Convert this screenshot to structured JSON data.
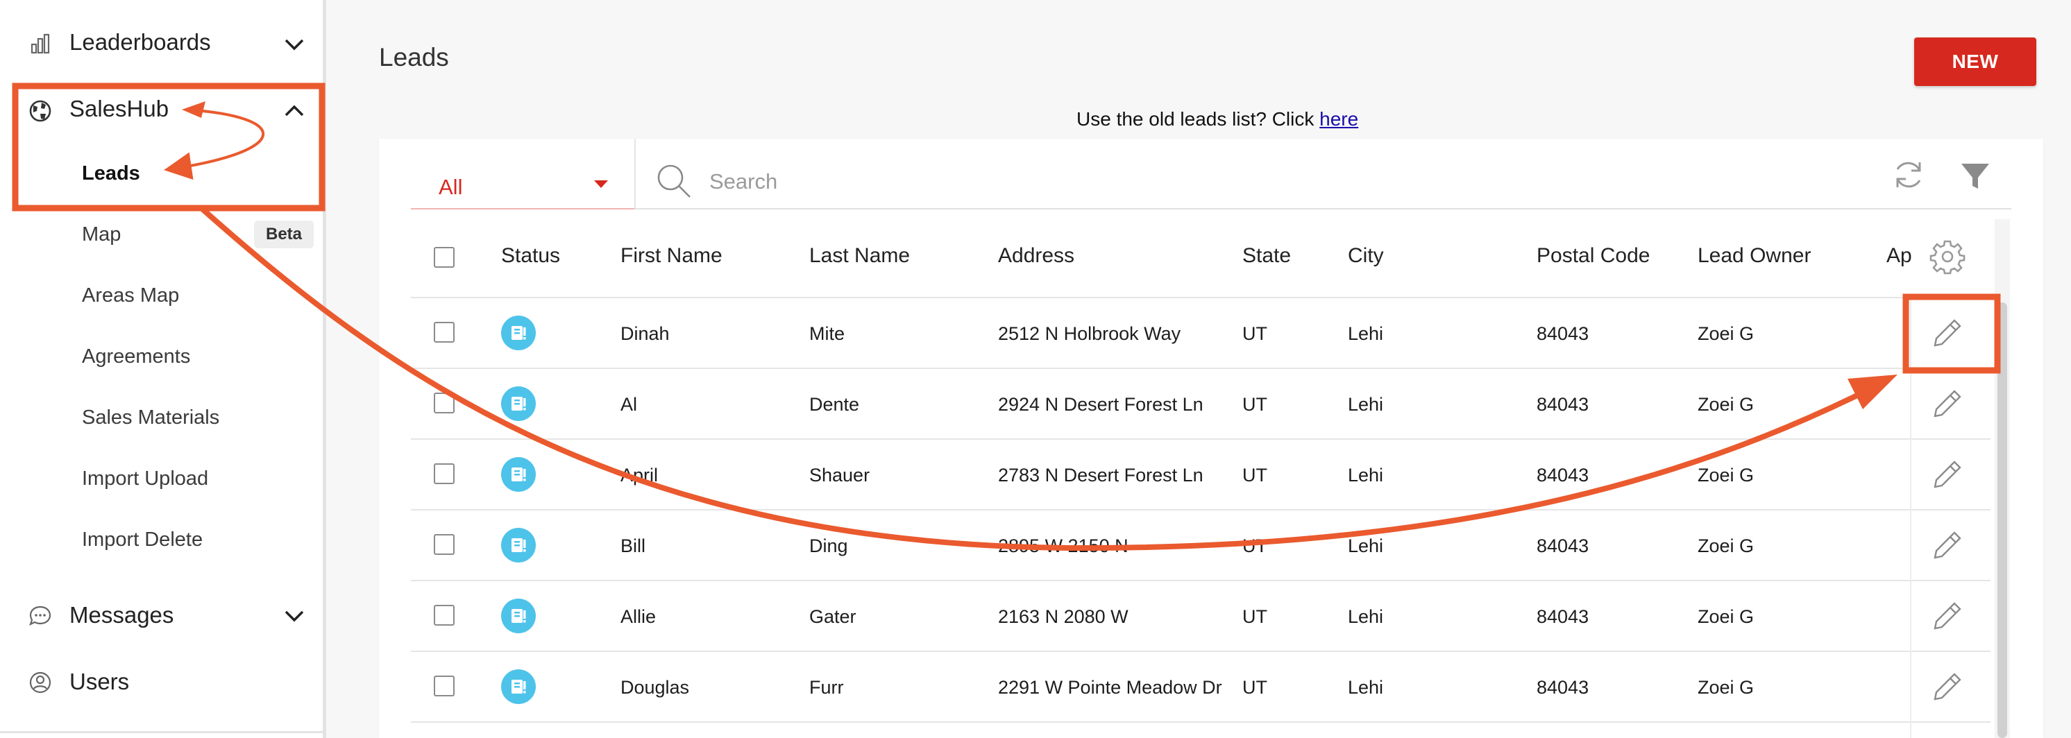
{
  "sidebar": {
    "leaderboards_label": "Leaderboards",
    "saleshub_label": "SalesHub",
    "sub_items": {
      "leads": "Leads",
      "map": "Map",
      "map_badge": "Beta",
      "areas_map": "Areas Map",
      "agreements": "Agreements",
      "sales_materials": "Sales Materials",
      "import_upload": "Import Upload",
      "import_delete": "Import Delete"
    },
    "messages_label": "Messages",
    "users_label": "Users"
  },
  "header": {
    "title": "Leads",
    "new_button": "NEW",
    "old_list_text": "Use the old leads list? Click ",
    "old_list_link": "here"
  },
  "toolbar": {
    "filter_value": "All",
    "search_placeholder": "Search"
  },
  "table": {
    "columns": [
      "Status",
      "First Name",
      "Last Name",
      "Address",
      "State",
      "City",
      "Postal Code",
      "Lead Owner",
      "Ap"
    ],
    "rows": [
      {
        "first": "Dinah",
        "last": "Mite",
        "address": "2512 N Holbrook Way",
        "state": "UT",
        "city": "Lehi",
        "postal": "84043",
        "owner": "Zoei G"
      },
      {
        "first": "Al",
        "last": "Dente",
        "address": "2924 N Desert Forest Ln",
        "state": "UT",
        "city": "Lehi",
        "postal": "84043",
        "owner": "Zoei G"
      },
      {
        "first": "April",
        "last": "Shauer",
        "address": "2783 N Desert Forest Ln",
        "state": "UT",
        "city": "Lehi",
        "postal": "84043",
        "owner": "Zoei G"
      },
      {
        "first": "Bill",
        "last": "Ding",
        "address": "2895 W 2150 N",
        "state": "UT",
        "city": "Lehi",
        "postal": "84043",
        "owner": "Zoei G"
      },
      {
        "first": "Allie",
        "last": "Gater",
        "address": "2163 N 2080 W",
        "state": "UT",
        "city": "Lehi",
        "postal": "84043",
        "owner": "Zoei G"
      },
      {
        "first": "Douglas",
        "last": "Furr",
        "address": "2291 W Pointe Meadow Dr",
        "state": "UT",
        "city": "Lehi",
        "postal": "84043",
        "owner": "Zoei G"
      }
    ]
  },
  "colors": {
    "accent": "#d6281f",
    "status_icon": "#4dc3ea",
    "annotation": "#ea5a2e"
  },
  "icons": [
    "chart-bar-icon",
    "globe-icon",
    "chevron-down-icon",
    "chevron-up-icon",
    "message-icon",
    "user-icon",
    "search-icon",
    "refresh-icon",
    "filter-icon",
    "gear-icon",
    "pencil-edit-icon",
    "lead-status-icon"
  ]
}
